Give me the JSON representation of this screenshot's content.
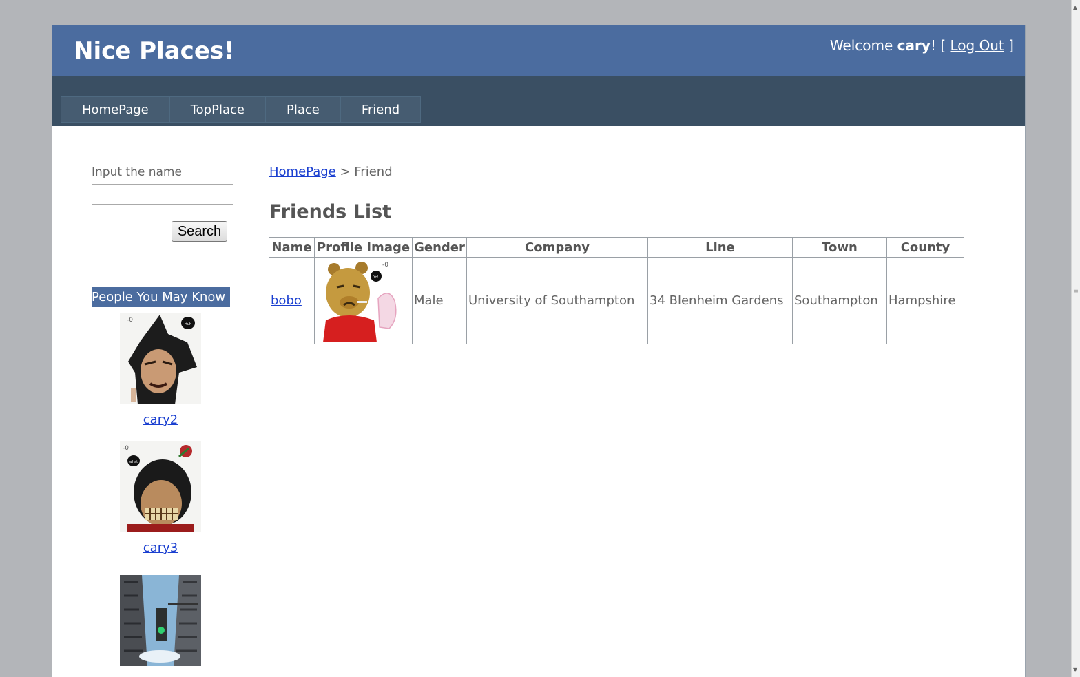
{
  "header": {
    "site_title": "Nice Places!",
    "welcome_prefix": "Welcome ",
    "username": "cary",
    "welcome_suffix": "! [ ",
    "logout_label": "Log Out",
    "close_bracket": " ]"
  },
  "menu": {
    "items": [
      {
        "label": "HomePage"
      },
      {
        "label": "TopPlace"
      },
      {
        "label": "Place"
      },
      {
        "label": "Friend"
      }
    ]
  },
  "sidebar": {
    "search_label": "Input the name",
    "search_value": "",
    "search_button": "Search",
    "people_header": "People You May Know",
    "people": [
      {
        "name": "cary2"
      },
      {
        "name": "cary3"
      },
      {
        "name": ""
      }
    ]
  },
  "breadcrumb": {
    "home": "HomePage",
    "separator": " > ",
    "current": "Friend"
  },
  "friends": {
    "title": "Friends List",
    "columns": [
      "Name",
      "Profile Image",
      "Gender",
      "Company",
      "Line",
      "Town",
      "County"
    ],
    "rows": [
      {
        "name": "bobo",
        "gender": "Male",
        "company": "University of Southampton",
        "line": "34 Blenheim Gardens",
        "town": "Southampton",
        "county": "Hampshire"
      }
    ]
  },
  "colors": {
    "header_blue": "#4b6c9f",
    "menu_dark": "#3a4f63",
    "link_blue": "#1a3fd0"
  }
}
